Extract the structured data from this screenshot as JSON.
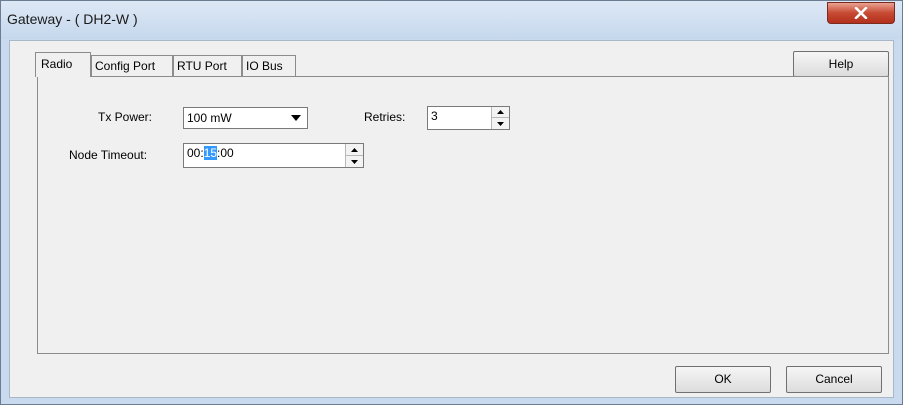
{
  "window": {
    "title": "Gateway - ( DH2-W )",
    "close_icon": "close-icon"
  },
  "tabs": [
    {
      "label": "Radio",
      "active": true
    },
    {
      "label": "Config Port",
      "active": false
    },
    {
      "label": "RTU Port",
      "active": false
    },
    {
      "label": "IO Bus",
      "active": false
    }
  ],
  "help_label": "Help",
  "radio": {
    "tx_power_label": "Tx Power:",
    "tx_power_value": "100 mW",
    "retries_label": "Retries:",
    "retries_value": "3",
    "node_timeout_label": "Node Timeout:",
    "node_timeout_hours": "00:",
    "node_timeout_minutes_selected": "15",
    "node_timeout_seconds": ":00"
  },
  "footer": {
    "ok_label": "OK",
    "cancel_label": "Cancel"
  }
}
